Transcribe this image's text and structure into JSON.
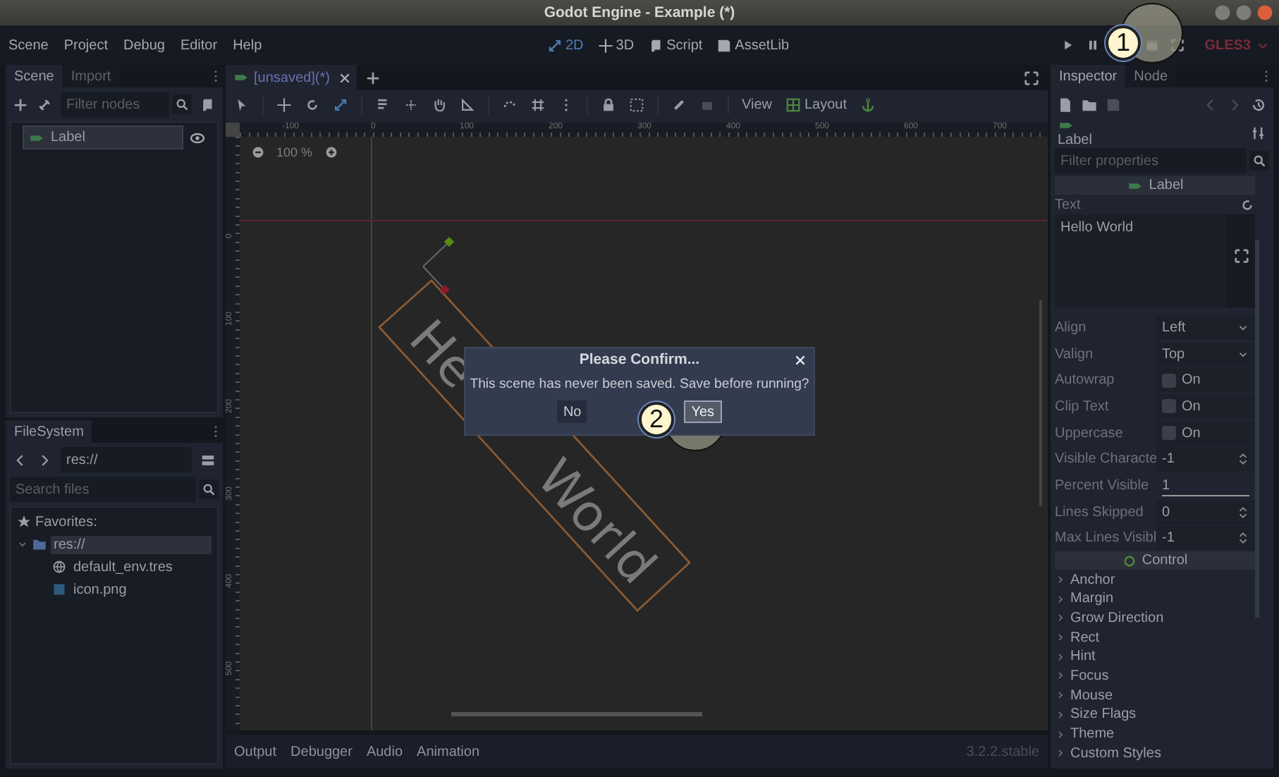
{
  "window": {
    "title": "Godot Engine - Example (*)"
  },
  "menu": [
    "Scene",
    "Project",
    "Debug",
    "Editor",
    "Help"
  ],
  "workspaces": [
    {
      "label": "2D",
      "selected": true
    },
    {
      "label": "3D",
      "selected": false
    },
    {
      "label": "Script",
      "selected": false
    },
    {
      "label": "AssetLib",
      "selected": false
    }
  ],
  "renderer": "GLES3",
  "scene_dock": {
    "tabs": [
      {
        "label": "Scene",
        "selected": true
      },
      {
        "label": "Import",
        "selected": false
      }
    ],
    "filter": {
      "placeholder": "Filter nodes"
    },
    "tree": [
      {
        "label": "Label",
        "selected": true,
        "visible": true
      }
    ]
  },
  "filesystem_dock": {
    "tabs": [
      {
        "label": "FileSystem",
        "selected": true
      }
    ],
    "path": "res://",
    "search": {
      "placeholder": "Search files"
    },
    "favorites": "Favorites:",
    "tree": [
      {
        "label": "res://",
        "kind": "folder",
        "selected": true,
        "expanded": true,
        "children": [
          {
            "label": "default_env.tres",
            "kind": "environment",
            "selected": false
          },
          {
            "label": "icon.png",
            "kind": "image",
            "selected": false
          }
        ]
      }
    ]
  },
  "scene_tabs": [
    {
      "label": "[unsaved](*)",
      "selected": true
    }
  ],
  "canvas_toolbar": {
    "view": "View",
    "layout": "Layout"
  },
  "zoom": "100 %",
  "ruler": {
    "horizontal": [
      "-100",
      "0",
      "100",
      "200",
      "300",
      "400",
      "500",
      "600",
      "700"
    ],
    "vertical": [
      "0",
      "100",
      "200",
      "300",
      "400",
      "500"
    ]
  },
  "canvas_text_parts": [
    "He",
    "World"
  ],
  "bottom_tabs": [
    "Output",
    "Debugger",
    "Audio",
    "Animation"
  ],
  "version": "3.2.2.stable",
  "inspector": {
    "tabs": [
      {
        "label": "Inspector",
        "selected": true
      },
      {
        "label": "Node",
        "selected": false
      }
    ],
    "object": "Label",
    "filter": {
      "placeholder": "Filter properties"
    },
    "class_header": "Label",
    "text_property": {
      "name": "Text",
      "value": "Hello World"
    },
    "properties": [
      {
        "name": "Align",
        "kind": "dropdown",
        "value": "Left"
      },
      {
        "name": "Valign",
        "kind": "dropdown",
        "value": "Top"
      },
      {
        "name": "Autowrap",
        "kind": "checkbox",
        "value": "On",
        "checked": false
      },
      {
        "name": "Clip Text",
        "kind": "checkbox",
        "value": "On",
        "checked": false
      },
      {
        "name": "Uppercase",
        "kind": "checkbox",
        "value": "On",
        "checked": false
      },
      {
        "name": "Visible Characte",
        "kind": "spin",
        "value": "-1"
      },
      {
        "name": "Percent Visible",
        "kind": "range",
        "value": "1",
        "level": 1
      },
      {
        "name": "Lines Skipped",
        "kind": "spin",
        "value": "0"
      },
      {
        "name": "Max Lines Visibl",
        "kind": "spin",
        "value": "-1"
      }
    ],
    "group_header": "Control",
    "sections": [
      {
        "label": "Anchor",
        "expanded": false
      },
      {
        "label": "Margin",
        "expanded": false
      },
      {
        "label": "Grow Direction",
        "expanded": false
      },
      {
        "label": "Rect",
        "expanded": false
      },
      {
        "label": "Hint",
        "expanded": false
      },
      {
        "label": "Focus",
        "expanded": false
      },
      {
        "label": "Mouse",
        "expanded": false
      },
      {
        "label": "Size Flags",
        "expanded": false
      },
      {
        "label": "Theme",
        "expanded": false
      },
      {
        "label": "Custom Styles",
        "expanded": false
      }
    ]
  },
  "dialog": {
    "title": "Please Confirm...",
    "message": "This scene has never been saved. Save before running?",
    "buttons": [
      {
        "label": "No",
        "selected": false
      },
      {
        "label": "Yes",
        "selected": true
      }
    ]
  },
  "callouts": [
    "1",
    "2"
  ]
}
